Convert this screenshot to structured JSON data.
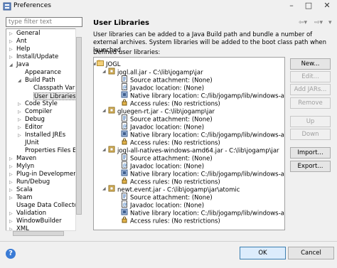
{
  "window": {
    "title": "Preferences"
  },
  "filter": {
    "placeholder": "type filter text"
  },
  "sidebar": {
    "items": [
      {
        "label": "General",
        "indent": 0,
        "selected": false
      },
      {
        "label": "Ant",
        "indent": 0,
        "selected": false
      },
      {
        "label": "Help",
        "indent": 0,
        "selected": false
      },
      {
        "label": "Install/Update",
        "indent": 0,
        "selected": false
      },
      {
        "label": "Java",
        "indent": 0,
        "selected": false
      },
      {
        "label": "Appearance",
        "indent": 1,
        "selected": false
      },
      {
        "label": "Build Path",
        "indent": 1,
        "selected": false
      },
      {
        "label": "Classpath Variab",
        "indent": 2,
        "selected": false
      },
      {
        "label": "User Libraries",
        "indent": 2,
        "selected": true
      },
      {
        "label": "Code Style",
        "indent": 1,
        "selected": false
      },
      {
        "label": "Compiler",
        "indent": 1,
        "selected": false
      },
      {
        "label": "Debug",
        "indent": 1,
        "selected": false
      },
      {
        "label": "Editor",
        "indent": 1,
        "selected": false
      },
      {
        "label": "Installed JREs",
        "indent": 1,
        "selected": false
      },
      {
        "label": "JUnit",
        "indent": 1,
        "selected": false
      },
      {
        "label": "Properties Files Edit",
        "indent": 1,
        "selected": false
      },
      {
        "label": "Maven",
        "indent": 0,
        "selected": false
      },
      {
        "label": "Mylyn",
        "indent": 0,
        "selected": false
      },
      {
        "label": "Plug-in Development",
        "indent": 0,
        "selected": false
      },
      {
        "label": "Run/Debug",
        "indent": 0,
        "selected": false
      },
      {
        "label": "Scala",
        "indent": 0,
        "selected": false
      },
      {
        "label": "Team",
        "indent": 0,
        "selected": false
      },
      {
        "label": "Usage Data Collector",
        "indent": 0,
        "selected": false
      },
      {
        "label": "Validation",
        "indent": 0,
        "selected": false
      },
      {
        "label": "WindowBuilder",
        "indent": 0,
        "selected": false
      },
      {
        "label": "XML",
        "indent": 0,
        "selected": false
      }
    ]
  },
  "main": {
    "title": "User Libraries",
    "description": "User libraries can be added to a Java Build path and bundle a number of external archives. System libraries will be added to the boot class path when launched.",
    "defined_label": "Defined user libraries:",
    "library": {
      "name": "JOGL",
      "jars": [
        {
          "label": "jogl.all.jar - C:\\lib\\jogamp\\jar",
          "children": [
            "Source attachment: (None)",
            "Javadoc location: (None)",
            "Native library location: C:/lib/jogamp/lib/windows-amd64",
            "Access rules: (No restrictions)"
          ]
        },
        {
          "label": "gluegen-rt.jar - C:\\lib\\jogamp\\jar",
          "children": [
            "Source attachment: (None)",
            "Javadoc location: (None)",
            "Native library location: C:/lib/jogamp/lib/windows-amd64",
            "Access rules: (No restrictions)"
          ]
        },
        {
          "label": "jogl-all-natives-windows-amd64.jar - C:\\lib\\jogamp\\jar",
          "children": [
            "Source attachment: (None)",
            "Javadoc location: (None)",
            "Native library location: C:/lib/jogamp/lib/windows-amd64",
            "Access rules: (No restrictions)"
          ]
        },
        {
          "label": "newt.event.jar - C:\\lib\\jogamp\\jar\\atomic",
          "children": [
            "Source attachment: (None)",
            "Javadoc location: (None)",
            "Native library location: C:/lib/jogamp/lib/windows-amd64",
            "Access rules: (No restrictions)"
          ]
        }
      ]
    },
    "buttons": {
      "new": "New...",
      "edit": "Edit...",
      "add_jars": "Add JARs...",
      "remove": "Remove",
      "up": "Up",
      "down": "Down",
      "import": "Import...",
      "export": "Export..."
    }
  },
  "footer": {
    "ok": "OK",
    "cancel": "Cancel"
  },
  "icons": {
    "app": "preferences-icon",
    "help": "help-icon",
    "back": "back-arrow-icon",
    "forward": "forward-arrow-icon",
    "menu": "view-menu-icon"
  },
  "colors": {
    "accent": "#3c7fb1",
    "selection": "#e6e6e6"
  }
}
